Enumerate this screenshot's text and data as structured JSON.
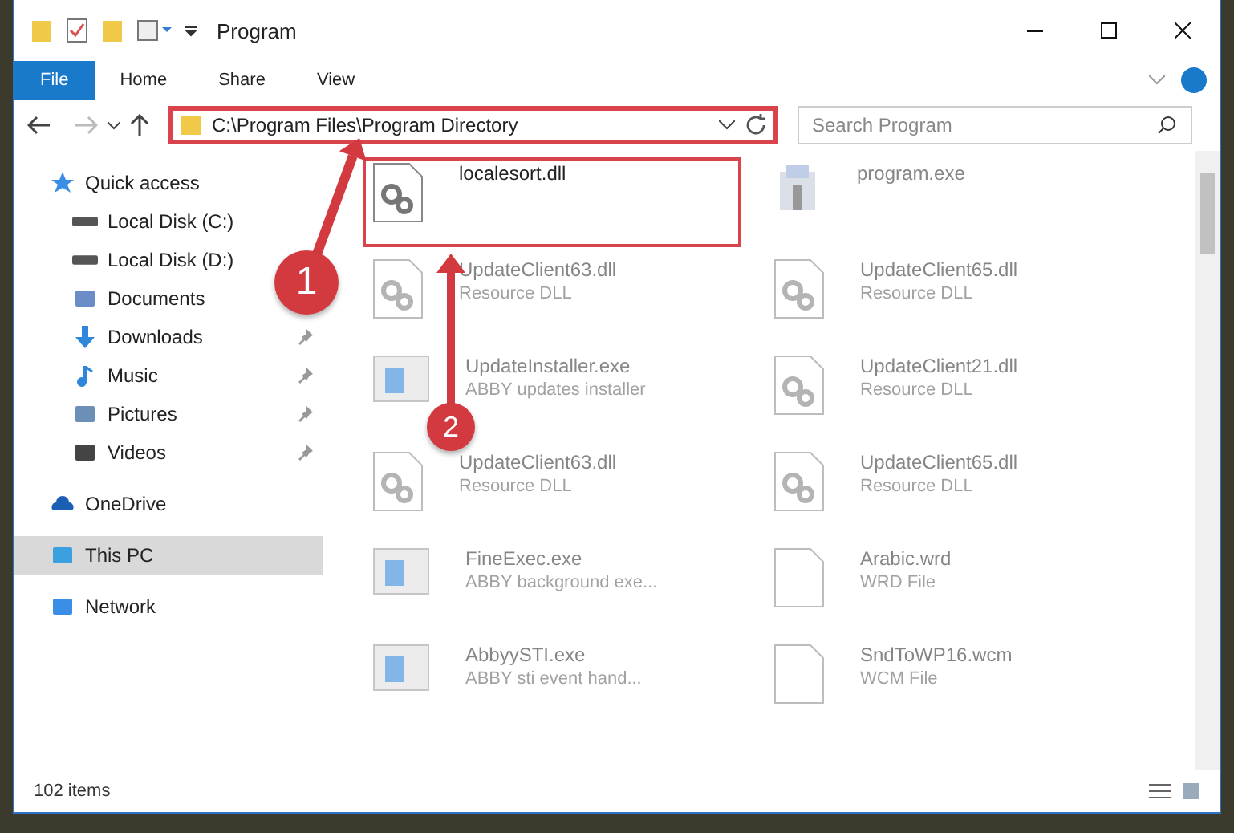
{
  "window": {
    "title": "Program"
  },
  "ribbon_tabs": [
    {
      "label": "File",
      "selected": true
    },
    {
      "label": "Home",
      "selected": false
    },
    {
      "label": "Share",
      "selected": false
    },
    {
      "label": "View",
      "selected": false
    }
  ],
  "address_bar": {
    "path": "C:\\Program Files\\Program Directory",
    "highlighted": true
  },
  "search": {
    "placeholder": "Search Program"
  },
  "sidebar": {
    "items": [
      {
        "label": "Quick access",
        "kind": "star",
        "selected": false,
        "children": [
          {
            "label": "Local Disk (C:)",
            "kind": "disk",
            "pinned": false,
            "selected": false
          },
          {
            "label": "Local Disk (D:)",
            "kind": "disk",
            "pinned": false,
            "selected": false
          },
          {
            "label": "Documents",
            "kind": "doc",
            "pinned": false,
            "selected": false
          },
          {
            "label": "Downloads",
            "kind": "download",
            "pinned": true,
            "selected": false
          },
          {
            "label": "Music",
            "kind": "music",
            "pinned": true,
            "selected": false
          },
          {
            "label": "Pictures",
            "kind": "picture",
            "pinned": true,
            "selected": false
          },
          {
            "label": "Videos",
            "kind": "video",
            "pinned": true,
            "selected": false
          }
        ]
      },
      {
        "label": "OneDrive",
        "kind": "cloud",
        "selected": false
      },
      {
        "label": "This PC",
        "kind": "pc",
        "selected": true
      },
      {
        "label": "Network",
        "kind": "network",
        "selected": false
      }
    ]
  },
  "files": [
    {
      "name": "localesort.dll",
      "kind": "dll",
      "faded": false,
      "highlighted": true
    },
    {
      "name": "program.exe",
      "kind": "app",
      "faded": true,
      "highlighted": false
    },
    {
      "name": "UpdateClient63.dll",
      "description": "Resource DLL",
      "kind": "dll",
      "faded": true,
      "highlighted": false
    },
    {
      "name": "UpdateClient65.dll",
      "description": "Resource DLL",
      "kind": "dll",
      "faded": true,
      "highlighted": false
    },
    {
      "name": "UpdateInstaller.exe",
      "description": "ABBY updates installer",
      "kind": "exe",
      "faded": true,
      "highlighted": false
    },
    {
      "name": "UpdateClient21.dll",
      "description": "Resource DLL",
      "kind": "dll",
      "faded": true,
      "highlighted": false
    },
    {
      "name": "UpdateClient63.dll",
      "description": "Resource DLL",
      "kind": "dll",
      "faded": true,
      "highlighted": false
    },
    {
      "name": "UpdateClient65.dll",
      "description": "Resource DLL",
      "kind": "dll",
      "faded": true,
      "highlighted": false
    },
    {
      "name": "FineExec.exe",
      "description": "ABBY background exe...",
      "kind": "exe",
      "faded": true,
      "highlighted": false
    },
    {
      "name": "Arabic.wrd",
      "description": "WRD File",
      "kind": "file",
      "faded": true,
      "highlighted": false
    },
    {
      "name": "AbbyySTI.exe",
      "description": "ABBY sti event hand...",
      "kind": "exe",
      "faded": true,
      "highlighted": false
    },
    {
      "name": "SndToWP16.wcm",
      "description": "WCM File",
      "kind": "file",
      "faded": true,
      "highlighted": false
    }
  ],
  "status_bar": {
    "item_count": "102 items"
  },
  "annotations": [
    {
      "label": "1"
    },
    {
      "label": "2"
    }
  ]
}
